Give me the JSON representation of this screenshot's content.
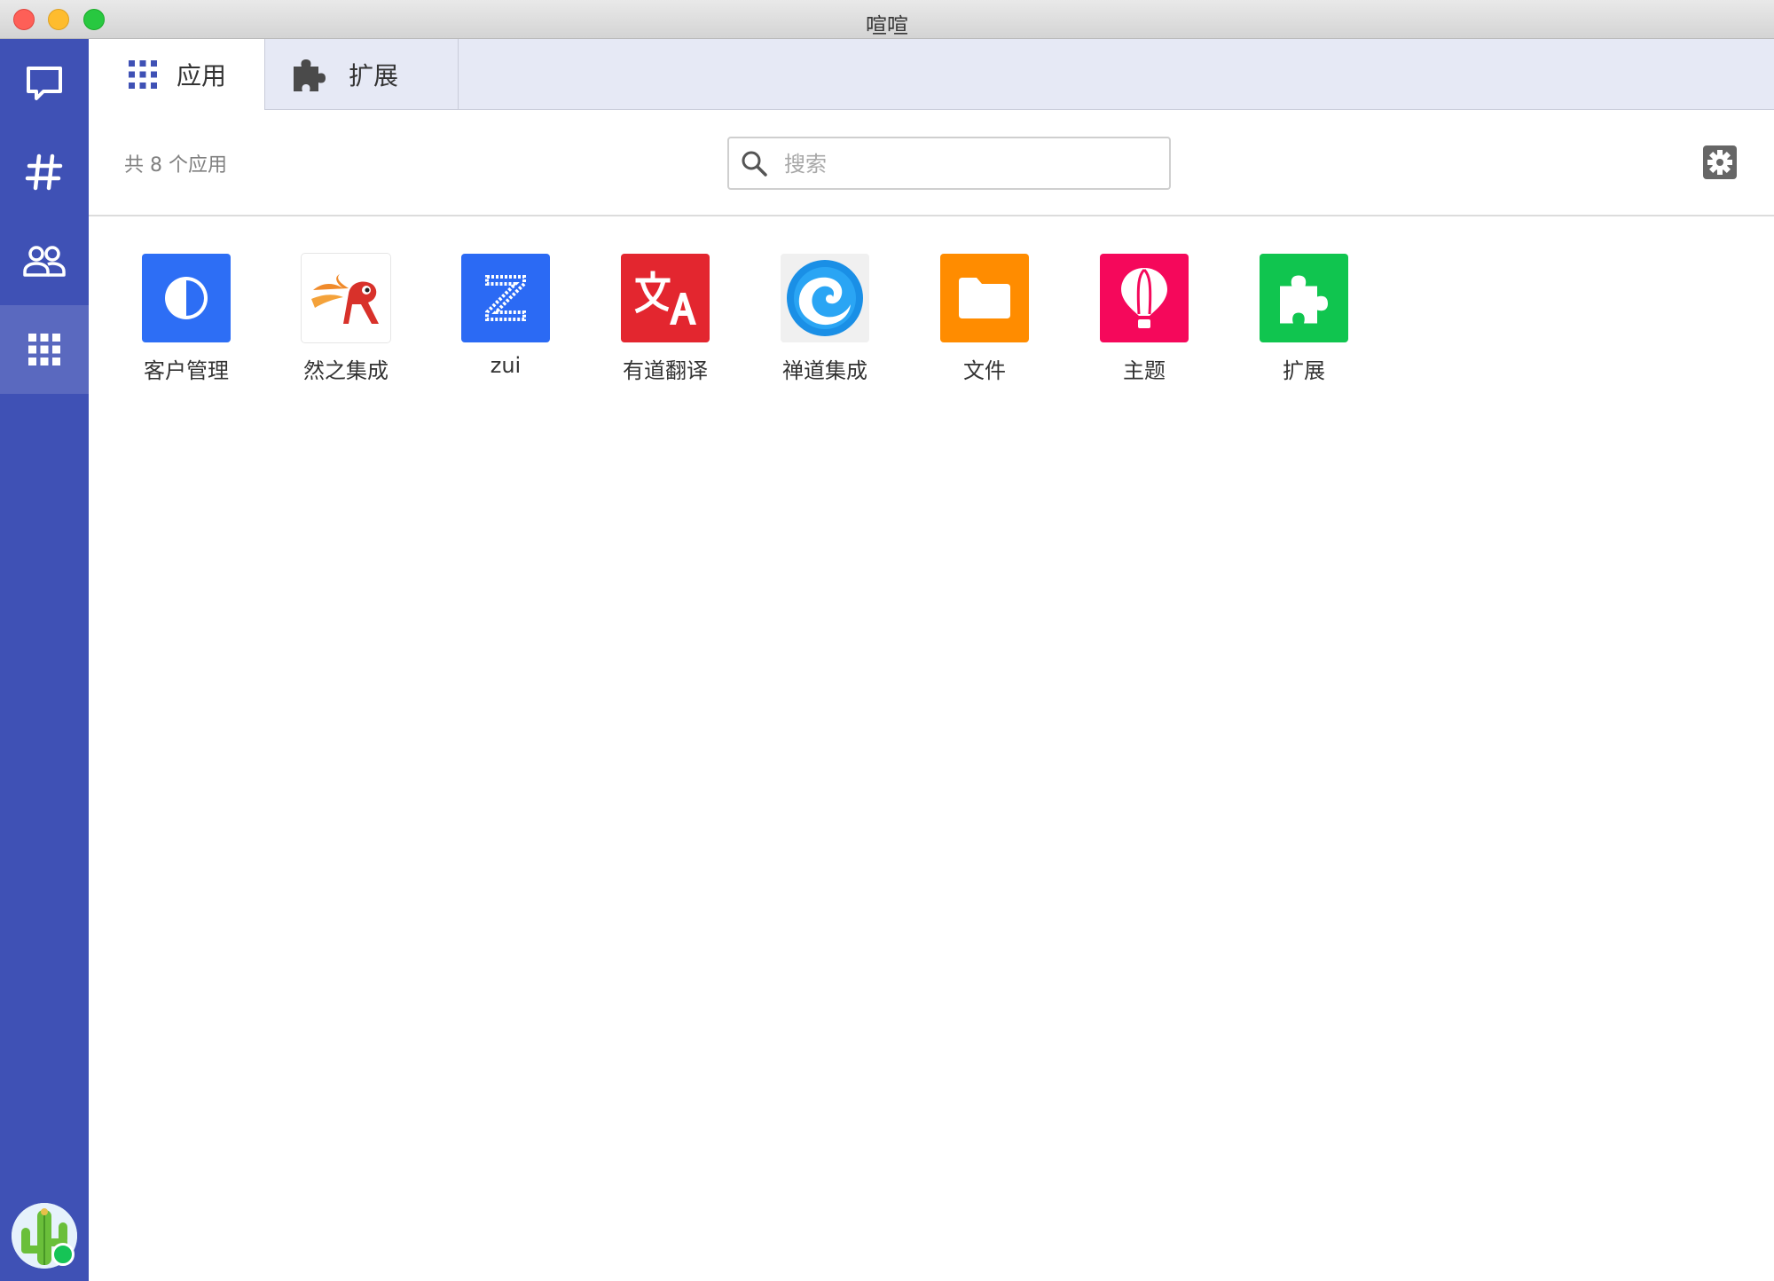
{
  "window": {
    "title": "喧喧"
  },
  "rail": {
    "items": [
      {
        "icon": "chat-bubble-icon"
      },
      {
        "icon": "hashtag-icon"
      },
      {
        "icon": "contacts-icon"
      },
      {
        "icon": "apps-grid-icon",
        "active": true
      }
    ],
    "avatar": {
      "icon": "cactus-avatar",
      "status_color": "#16c456"
    }
  },
  "tabs": [
    {
      "label": "应用",
      "icon": "apps-grid-icon",
      "active": true
    },
    {
      "label": "扩展",
      "icon": "puzzle-icon",
      "active": false
    }
  ],
  "toolbar": {
    "count_text": "共 8 个应用",
    "search": {
      "placeholder": "搜索",
      "value": ""
    },
    "settings_icon": "gear-icon"
  },
  "apps": [
    {
      "label": "客户管理",
      "icon": "crm-icon",
      "color": "#2d6ef5"
    },
    {
      "label": "然之集成",
      "icon": "ranzhi-icon",
      "color": "#ffffff"
    },
    {
      "label": "zui",
      "icon": "zui-icon",
      "color": "#2b6af4"
    },
    {
      "label": "有道翻译",
      "icon": "translate-icon",
      "color": "#e3262f"
    },
    {
      "label": "禅道集成",
      "icon": "zentao-icon",
      "color": "#f0f0f0"
    },
    {
      "label": "文件",
      "icon": "folder-icon",
      "color": "#ff8c00"
    },
    {
      "label": "主题",
      "icon": "balloon-icon",
      "color": "#f5085b"
    },
    {
      "label": "扩展",
      "icon": "puzzle-icon",
      "color": "#10c54f"
    }
  ],
  "colors": {
    "rail": "#3f51b5",
    "tabbar": "#e6e9f5",
    "accent": "#3f51b5"
  }
}
